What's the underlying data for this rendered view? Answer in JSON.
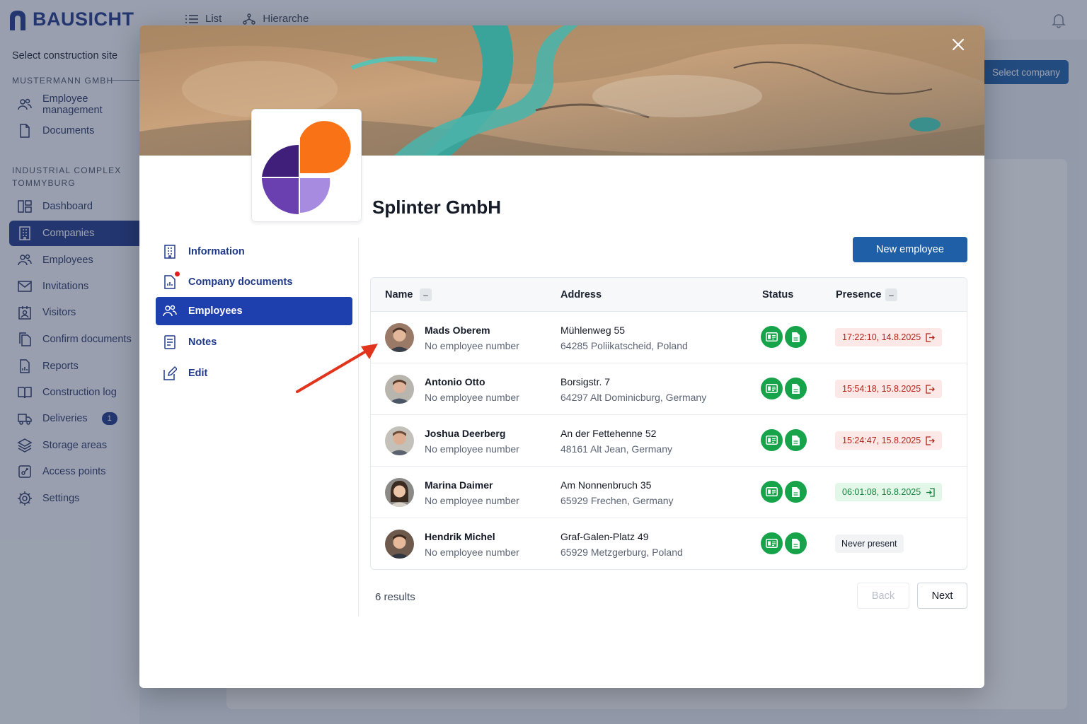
{
  "app": {
    "brand": "BAUSICHT",
    "topnav": {
      "list": "List",
      "hierarchy": "Hierarche"
    },
    "select_company": "Select company"
  },
  "sidebar": {
    "select_site": "Select construction site",
    "group1": "MUSTERMANN GMBH",
    "group1_items": [
      {
        "label": "Employee management",
        "icon": "users-icon"
      },
      {
        "label": "Documents",
        "icon": "document-icon"
      }
    ],
    "group2_line1": "INDUSTRIAL COMPLEX",
    "group2_line2": "TOMMYBURG",
    "items": [
      {
        "label": "Dashboard",
        "icon": "dashboard-icon"
      },
      {
        "label": "Companies",
        "icon": "building-icon",
        "active": true
      },
      {
        "label": "Employees",
        "icon": "users-icon"
      },
      {
        "label": "Invitations",
        "icon": "mail-icon"
      },
      {
        "label": "Visitors",
        "icon": "visitor-icon"
      },
      {
        "label": "Confirm documents",
        "icon": "documents-icon"
      },
      {
        "label": "Reports",
        "icon": "report-icon"
      },
      {
        "label": "Construction log",
        "icon": "book-icon"
      },
      {
        "label": "Deliveries",
        "icon": "truck-icon",
        "badge": "1"
      },
      {
        "label": "Storage areas",
        "icon": "layers-icon"
      },
      {
        "label": "Access points",
        "icon": "access-icon"
      },
      {
        "label": "Settings",
        "icon": "gear-icon"
      }
    ]
  },
  "modal": {
    "company_name": "Splinter GmbH",
    "nav": [
      {
        "label": "Information",
        "icon": "building-icon"
      },
      {
        "label": "Company documents",
        "icon": "document-chart-icon",
        "notification": true
      },
      {
        "label": "Employees",
        "icon": "users-icon",
        "active": true
      },
      {
        "label": "Notes",
        "icon": "notes-icon"
      },
      {
        "label": "Edit",
        "icon": "edit-icon"
      }
    ],
    "new_employee": "New employee",
    "table": {
      "headers": {
        "name": "Name",
        "address": "Address",
        "status": "Status",
        "presence": "Presence"
      },
      "sort_symbol": "–",
      "rows": [
        {
          "name": "Mads Oberem",
          "number": "No employee number",
          "address1": "Mühlenweg 55",
          "address2": "64285 Poliikatscheid, Poland",
          "presence": "17:22:10, 14.8.2025",
          "presence_state": "red"
        },
        {
          "name": "Antonio Otto",
          "number": "No employee number",
          "address1": "Borsigstr. 7",
          "address2": "64297 Alt Dominicburg, Germany",
          "presence": "15:54:18, 15.8.2025",
          "presence_state": "red"
        },
        {
          "name": "Joshua Deerberg",
          "number": "No employee number",
          "address1": "An der Fettehenne 52",
          "address2": "48161 Alt Jean, Germany",
          "presence": "15:24:47, 15.8.2025",
          "presence_state": "red"
        },
        {
          "name": "Marina Daimer",
          "number": "No employee number",
          "address1": "Am Nonnenbruch 35",
          "address2": "65929 Frechen, Germany",
          "presence": "06:01:08, 16.8.2025",
          "presence_state": "green"
        },
        {
          "name": "Hendrik Michel",
          "number": "No employee number",
          "address1": "Graf-Galen-Platz 49",
          "address2": "65929 Metzgerburg, Poland",
          "presence": "Never present",
          "presence_state": "gray"
        }
      ]
    },
    "results": "6 results",
    "back": "Back",
    "next": "Next"
  },
  "colors": {
    "primary": "#1e40af",
    "accent": "#1e5fa8",
    "status_green": "#16a34a",
    "presence_red": "#b42318",
    "logo_orange": "#f97316",
    "logo_purple": "#5b2d99"
  }
}
